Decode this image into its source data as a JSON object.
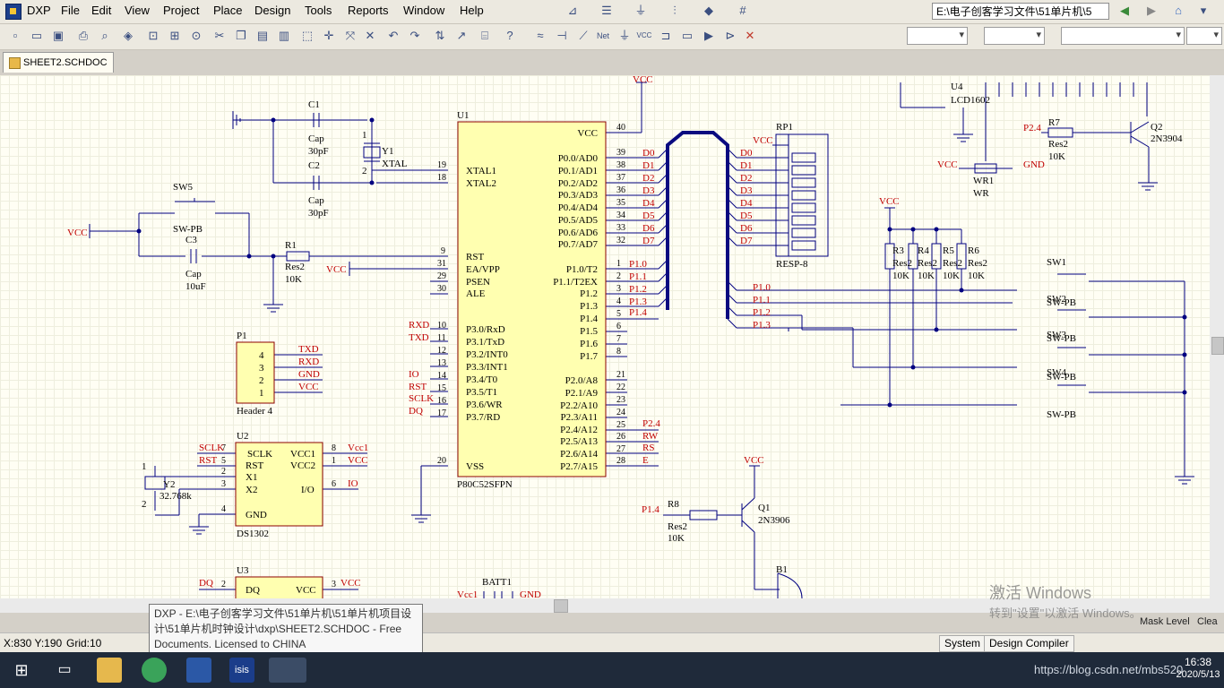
{
  "app": {
    "name": "DXP"
  },
  "menu": [
    "File",
    "Edit",
    "View",
    "Project",
    "Place",
    "Design",
    "Tools",
    "Reports",
    "Window",
    "Help"
  ],
  "path_box": "E:\\电子创客学习文件\\51单片机\\5",
  "document_tab": "SHEET2.SCHDOC",
  "schematic": {
    "u1": {
      "ref": "U1",
      "part": "P80C52SFPN",
      "left_pins": [
        {
          "num": "19",
          "name": "XTAL1"
        },
        {
          "num": "18",
          "name": "XTAL2"
        },
        {
          "num": "9",
          "name": "RST"
        },
        {
          "num": "31",
          "name": "EA/VPP"
        },
        {
          "num": "29",
          "name": "PSEN"
        },
        {
          "num": "30",
          "name": "ALE"
        },
        {
          "num": "10",
          "name": "P3.0/RxD",
          "net": "RXD"
        },
        {
          "num": "11",
          "name": "P3.1/TxD",
          "net": "TXD"
        },
        {
          "num": "12",
          "name": "P3.2/INT0"
        },
        {
          "num": "13",
          "name": "P3.3/INT1"
        },
        {
          "num": "14",
          "name": "P3.4/T0",
          "net": "IO"
        },
        {
          "num": "15",
          "name": "P3.5/T1",
          "net": "RST"
        },
        {
          "num": "16",
          "name": "P3.6/WR",
          "net": "SCLK"
        },
        {
          "num": "17",
          "name": "P3.7/RD",
          "net": "DQ"
        },
        {
          "num": "20",
          "name": "VSS"
        }
      ],
      "right_pins": [
        {
          "num": "40",
          "name": "VCC"
        },
        {
          "num": "39",
          "name": "P0.0/AD0",
          "net": "D0"
        },
        {
          "num": "38",
          "name": "P0.1/AD1",
          "net": "D1"
        },
        {
          "num": "37",
          "name": "P0.2/AD2",
          "net": "D2"
        },
        {
          "num": "36",
          "name": "P0.3/AD3",
          "net": "D3"
        },
        {
          "num": "35",
          "name": "P0.4/AD4",
          "net": "D4"
        },
        {
          "num": "34",
          "name": "P0.5/AD5",
          "net": "D5"
        },
        {
          "num": "33",
          "name": "P0.6/AD6",
          "net": "D6"
        },
        {
          "num": "32",
          "name": "P0.7/AD7",
          "net": "D7"
        },
        {
          "num": "1",
          "name": "P1.0/T2",
          "net": "P1.0"
        },
        {
          "num": "2",
          "name": "P1.1/T2EX",
          "net": "P1.1"
        },
        {
          "num": "3",
          "name": "P1.2",
          "net": "P1.2"
        },
        {
          "num": "4",
          "name": "P1.3",
          "net": "P1.3"
        },
        {
          "num": "5",
          "name": "P1.4",
          "net": "P1.4"
        },
        {
          "num": "6",
          "name": "P1.5"
        },
        {
          "num": "7",
          "name": "P1.6"
        },
        {
          "num": "8",
          "name": "P1.7"
        },
        {
          "num": "21",
          "name": "P2.0/A8"
        },
        {
          "num": "22",
          "name": "P2.1/A9"
        },
        {
          "num": "23",
          "name": "P2.2/A10"
        },
        {
          "num": "24",
          "name": "P2.3/A11"
        },
        {
          "num": "25",
          "name": "P2.4/A12",
          "net": "P2.4"
        },
        {
          "num": "26",
          "name": "P2.5/A13",
          "net": "RW"
        },
        {
          "num": "27",
          "name": "P2.6/A14",
          "net": "RS"
        },
        {
          "num": "28",
          "name": "P2.7/A15",
          "net": "E"
        }
      ]
    },
    "rp1": {
      "ref": "RP1",
      "part": "RESP-8",
      "vcc": "VCC",
      "nets": [
        "D0",
        "D1",
        "D2",
        "D3",
        "D4",
        "D5",
        "D6",
        "D7"
      ]
    },
    "u2": {
      "ref": "U2",
      "part": "DS1302",
      "left": [
        {
          "num": "7",
          "name": "SCLK",
          "net": "SCLK"
        },
        {
          "num": "5",
          "name": "RST",
          "net": "RST"
        },
        {
          "num": "2",
          "name": "X1"
        },
        {
          "num": "3",
          "name": "X2"
        },
        {
          "num": "4",
          "name": "GND"
        }
      ],
      "right": [
        {
          "num": "8",
          "name": "VCC1",
          "net": "Vcc1"
        },
        {
          "num": "1",
          "name": "VCC2",
          "net": "VCC"
        },
        {
          "num": "6",
          "name": "I/O",
          "net": "IO"
        }
      ]
    },
    "y2": {
      "ref": "Y2",
      "value": "32.768k",
      "pin1": "1",
      "pin2": "2"
    },
    "y1": {
      "ref": "Y1",
      "value": "XTAL",
      "pin1": "1",
      "pin2": "2"
    },
    "p1": {
      "ref": "P1",
      "part": "Header 4",
      "pins": [
        {
          "num": "4",
          "net": "TXD"
        },
        {
          "num": "3",
          "net": "RXD"
        },
        {
          "num": "2",
          "net": "GND"
        },
        {
          "num": "1",
          "net": "VCC"
        }
      ]
    },
    "c1": {
      "ref": "C1",
      "type": "Cap",
      "value": "30pF"
    },
    "c2": {
      "ref": "C2",
      "type": "Cap",
      "value": "30pF"
    },
    "c3": {
      "ref": "C3",
      "type": "Cap",
      "value": "10uF"
    },
    "r1": {
      "ref": "R1",
      "type": "Res2",
      "value": "10K"
    },
    "sw5": {
      "ref": "SW5",
      "type": "SW-PB"
    },
    "vcc_labels": {
      "left": "VCC",
      "ea": "VCC",
      "top": "VCC",
      "rp": "VCC",
      "u3": "VCC",
      "q1": "VCC",
      "switches": "VCC",
      "wr": "VCC"
    },
    "u3": {
      "ref": "U3",
      "pins": [
        {
          "num": "2",
          "name": "DQ",
          "net": "DQ"
        },
        {
          "num": "3",
          "name": "VCC",
          "net": "VCC"
        }
      ]
    },
    "batt1": {
      "ref": "BATT1",
      "left": "Vcc1",
      "right": "GND"
    },
    "q1": {
      "ref": "Q1",
      "part": "2N3906"
    },
    "q2": {
      "ref": "Q2",
      "part": "2N3904"
    },
    "r8": {
      "ref": "R8",
      "type": "Res2",
      "value": "10K",
      "net": "P1.4"
    },
    "r7": {
      "ref": "R7",
      "type": "Res2",
      "value": "10K",
      "net": "P2.4"
    },
    "b1": {
      "ref": "B1"
    },
    "u4": {
      "ref": "U4",
      "part": "LCD1602"
    },
    "wr1": {
      "ref": "WR1",
      "type": "WR",
      "vcc": "VCC",
      "gnd": "GND"
    },
    "pullups": [
      {
        "ref": "R3",
        "type": "Res2",
        "value": "10K"
      },
      {
        "ref": "R4",
        "type": "Res2",
        "value": "10K"
      },
      {
        "ref": "R5",
        "type": "Res2",
        "value": "10K"
      },
      {
        "ref": "R6",
        "type": "Res2",
        "value": "10K"
      }
    ],
    "switches": [
      {
        "ref": "SW1",
        "type": "SW-PB",
        "net": "P1.0"
      },
      {
        "ref": "SW2",
        "type": "SW-PB",
        "net": "P1.1"
      },
      {
        "ref": "SW3",
        "type": "SW-PB",
        "net": "P1.2"
      },
      {
        "ref": "SW4",
        "type": "SW-PB",
        "net": "P1.3"
      }
    ]
  },
  "tooltip": "DXP - E:\\电子创客学习文件\\51单片机\\51单片机项目设计\\51单片机时钟设计\\dxp\\SHEET2.SCHDOC - Free Documents. Licensed to CHINA",
  "watermark": {
    "line1": "激活 Windows",
    "line2": "转到\"设置\"以激活 Windows。"
  },
  "panel": {
    "mask_level": "Mask Level",
    "clear": "Clea"
  },
  "status": {
    "coords": "X:830 Y:190",
    "grid": "Grid:10",
    "system": "System",
    "design_compiler": "Design Compiler"
  },
  "taskbar": {
    "url": "https://blog.csdn.net/mbs520",
    "time": "16:38",
    "date": "2020/5/13"
  }
}
